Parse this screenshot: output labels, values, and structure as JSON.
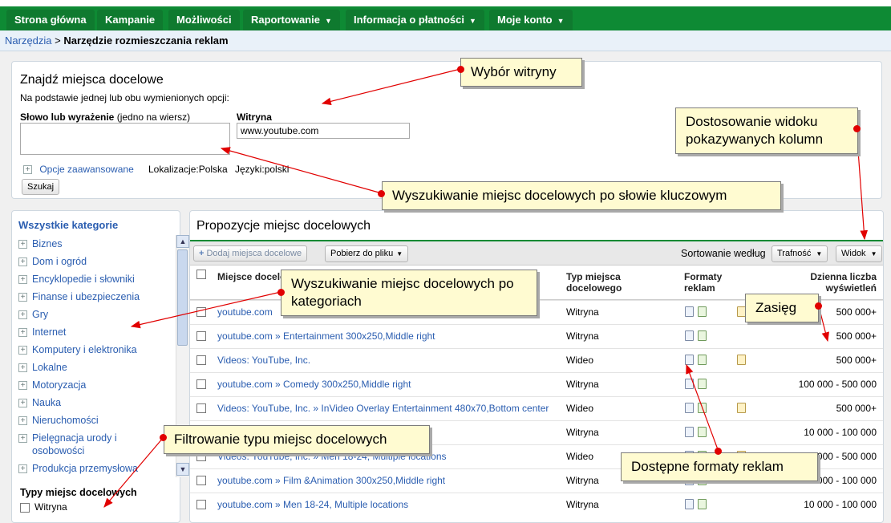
{
  "nav": {
    "tabs": [
      {
        "label": "Strona główna",
        "dropdown": false
      },
      {
        "label": "Kampanie",
        "dropdown": false
      },
      {
        "label": "Możliwości",
        "dropdown": false
      },
      {
        "label": "Raportowanie",
        "dropdown": true
      },
      {
        "label": "Informacja o płatności",
        "dropdown": true
      },
      {
        "label": "Moje konto",
        "dropdown": true
      }
    ]
  },
  "breadcrumb": {
    "link": "Narzędzia",
    "sep": " > ",
    "current": "Narzędzie rozmieszczania reklam"
  },
  "find": {
    "title": "Znajdź miejsca docelowe",
    "subtitle": "Na podstawie jednej lub obu wymienionych opcji:",
    "keyword_label_bold": "Słowo lub wyrażenie",
    "keyword_label_rest": " (jedno na wiersz)",
    "keyword_value": "",
    "site_label": "Witryna",
    "site_value": "www.youtube.com",
    "advanced_label": "Opcje zaawansowane",
    "location_label": "Lokalizacje:",
    "location_value": "Polska",
    "language_label": "Języki:",
    "language_value": "polski",
    "search_button": "Szukaj"
  },
  "categories": {
    "header": "Wszystkie kategorie",
    "items": [
      "Biznes",
      "Dom i ogród",
      "Encyklopedie i słowniki",
      "Finanse i ubezpieczenia",
      "Gry",
      "Internet",
      "Komputery i elektronika",
      "Lokalne",
      "Motoryzacja",
      "Nauka",
      "Nieruchomości",
      "Pielęgnacja urody i",
      "osobowości",
      "Produkcja przemysłowa"
    ],
    "types_header": "Typy miejsc docelowych",
    "types": [
      "Witryna"
    ]
  },
  "results": {
    "title": "Propozycje miejsc docelowych",
    "add_button": "Dodaj miejsca docelowe",
    "download_button": "Pobierz do pliku",
    "sort_label": "Sortowanie według",
    "sort_value": "Trafność",
    "view_button": "Widok",
    "columns": {
      "placement": "Miejsce docelo",
      "type": "Typ miejsca",
      "type2": "docelowego",
      "formats": "Formaty",
      "formats2": "reklam",
      "impressions": "Dzienna liczba",
      "impressions2": "wyświetleń"
    },
    "rows": [
      {
        "placement": "youtube.com",
        "type": "Witryna",
        "impressions": "500 000+",
        "video": true
      },
      {
        "placement": "youtube.com » Entertainment 300x250,Middle right",
        "type": "Witryna",
        "impressions": "500 000+",
        "video": false
      },
      {
        "placement": "Videos: YouTube, Inc.",
        "type": "Wideo",
        "impressions": "500 000+",
        "video": true
      },
      {
        "placement": "youtube.com » Comedy 300x250,Middle right",
        "type": "Witryna",
        "impressions": "100 000 - 500 000",
        "video": false
      },
      {
        "placement": "Videos: YouTube, Inc. » InVideo Overlay Entertainment 480x70,Bottom center",
        "type": "Wideo",
        "impressions": "500 000+",
        "video": true
      },
      {
        "placement": "ht",
        "type": "Witryna",
        "impressions": "10 000 - 100 000",
        "video": false
      },
      {
        "placement": "Videos: YouTube, Inc. » Men 18-24, Multiple locations",
        "type": "Wideo",
        "impressions": "100 000 - 500 000",
        "video": true
      },
      {
        "placement": "youtube.com » Film &Animation 300x250,Middle right",
        "type": "Witryna",
        "impressions": "10 000 - 100 000",
        "video": false
      },
      {
        "placement": "youtube.com » Men 18-24, Multiple locations",
        "type": "Witryna",
        "impressions": "10 000 - 100 000",
        "video": false
      }
    ]
  },
  "callouts": {
    "site": "Wybór witryny",
    "view": "Dostosowanie widoku pokazywanych kolumn",
    "keyword": "Wyszukiwanie miejsc docelowych po słowie kluczowym",
    "category": "Wyszukiwanie miejsc docelowych po kategoriach",
    "reach": "Zasięg",
    "filter": "Filtrowanie typu miejsc docelowych",
    "formats": "Dostępne formaty reklam"
  },
  "colors": {
    "nav_green": "#0e8a34",
    "link_blue": "#2a5db0",
    "callout_bg": "#fffbd1",
    "arrow_red": "#e10000"
  }
}
